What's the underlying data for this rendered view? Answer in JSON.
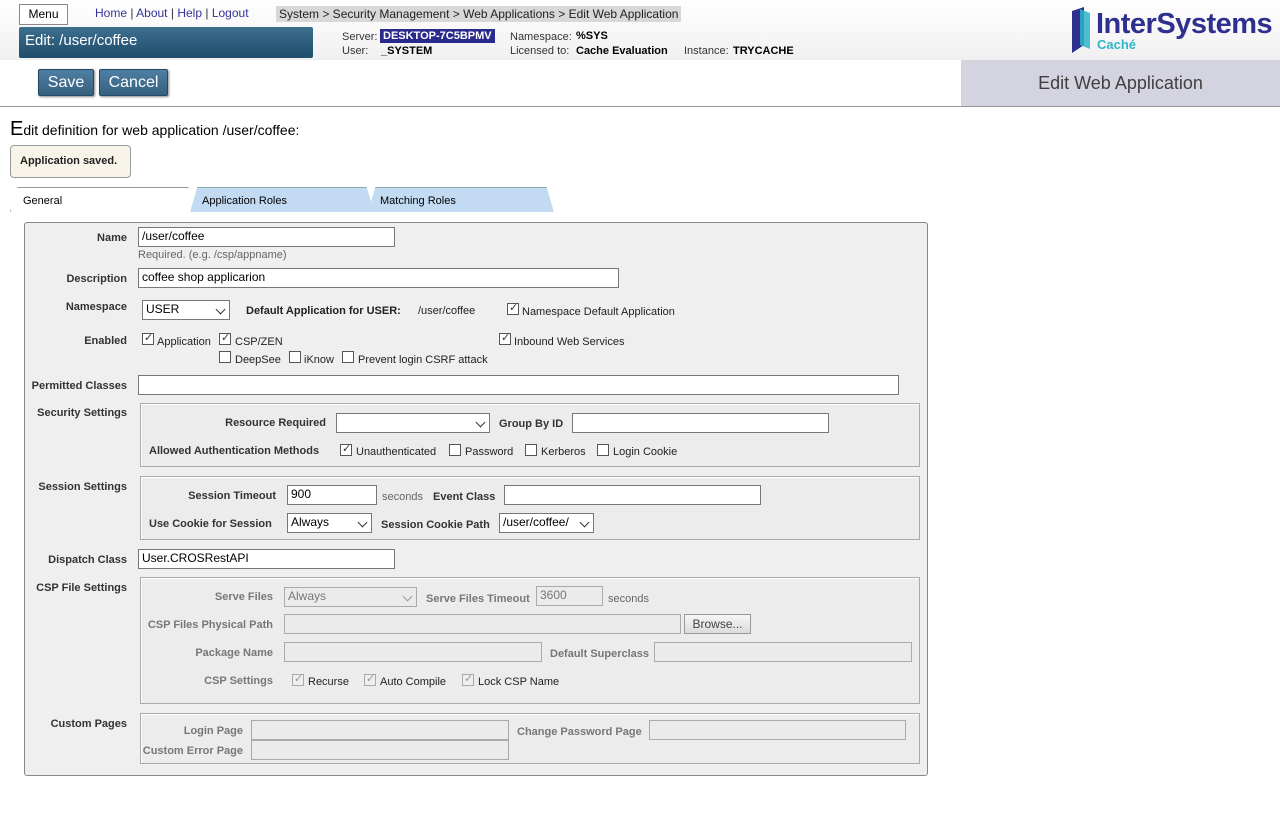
{
  "header": {
    "menu_label": "Menu",
    "links": {
      "home": "Home",
      "about": "About",
      "help": "Help",
      "logout": "Logout",
      "sep": "|"
    },
    "breadcrumb": "System > Security Management > Web Applications > Edit Web Application",
    "title": "Edit: /user/coffee",
    "server_label": "Server:",
    "server": "DESKTOP-7C5BPMV",
    "namespace_label": "Namespace:",
    "namespace": "%SYS",
    "user_label": "User:",
    "user": "_SYSTEM",
    "licensed_label": "Licensed to:",
    "licensed": "Cache Evaluation",
    "instance_label": "Instance:",
    "instance": "TRYCACHE",
    "logo_text": "InterSystems",
    "logo_sub": "Caché"
  },
  "toolbar": {
    "save_label": "Save",
    "cancel_label": "Cancel",
    "page_heading": "Edit Web Application"
  },
  "main": {
    "edit_def_first": "E",
    "edit_def_rest": "dit definition for web application /user/coffee:",
    "saved_message": "Application saved.",
    "tabs": [
      {
        "label": "General"
      },
      {
        "label": "Application Roles"
      },
      {
        "label": "Matching Roles"
      }
    ]
  },
  "form": {
    "name_label": "Name",
    "name_value": "/user/coffee",
    "name_hint": "Required. (e.g. /csp/appname)",
    "description_label": "Description",
    "description_value": "coffee shop applicarion",
    "namespace_label": "Namespace",
    "namespace_value": "USER",
    "default_app_label": "Default Application for USER:",
    "default_app_value": "/user/coffee",
    "ns_default_label": "Namespace Default Application",
    "enabled_label": "Enabled",
    "application_label": "Application",
    "cspzen_label": "CSP/ZEN",
    "inbound_label": "Inbound Web Services",
    "deepsee_label": "DeepSee",
    "iknow_label": "iKnow",
    "csrf_label": "Prevent login CSRF attack",
    "permitted_label": "Permitted Classes",
    "permitted_value": "",
    "security_label": "Security Settings",
    "resource_label": "Resource Required",
    "resource_value": "",
    "groupby_label": "Group By ID",
    "groupby_value": "",
    "auth_label": "Allowed Authentication Methods",
    "unauth_label": "Unauthenticated",
    "password_label": "Password",
    "kerberos_label": "Kerberos",
    "logincookie_label": "Login Cookie",
    "session_label": "Session Settings",
    "timeout_label": "Session Timeout",
    "timeout_value": "900",
    "seconds_label": "seconds",
    "eventclass_label": "Event Class",
    "eventclass_value": "",
    "usecookie_label": "Use Cookie for Session",
    "usecookie_value": "Always",
    "cookiepath_label": "Session Cookie Path",
    "cookiepath_value": "/user/coffee/",
    "dispatch_label": "Dispatch Class",
    "dispatch_value": "User.CROSRestAPI",
    "cspfile_label": "CSP File Settings",
    "servefiles_label": "Serve Files",
    "servefiles_value": "Always",
    "servetimeout_label": "Serve Files Timeout",
    "servetimeout_value": "3600",
    "physpath_label": "CSP Files Physical Path",
    "browse_label": "Browse...",
    "package_label": "Package Name",
    "superclass_label": "Default Superclass",
    "cspsettings_label": "CSP Settings",
    "recurse_label": "Recurse",
    "autocompile_label": "Auto Compile",
    "lockcsp_label": "Lock CSP Name",
    "custompages_label": "Custom Pages",
    "loginpage_label": "Login Page",
    "changepw_label": "Change Password Page",
    "customerror_label": "Custom Error Page"
  }
}
